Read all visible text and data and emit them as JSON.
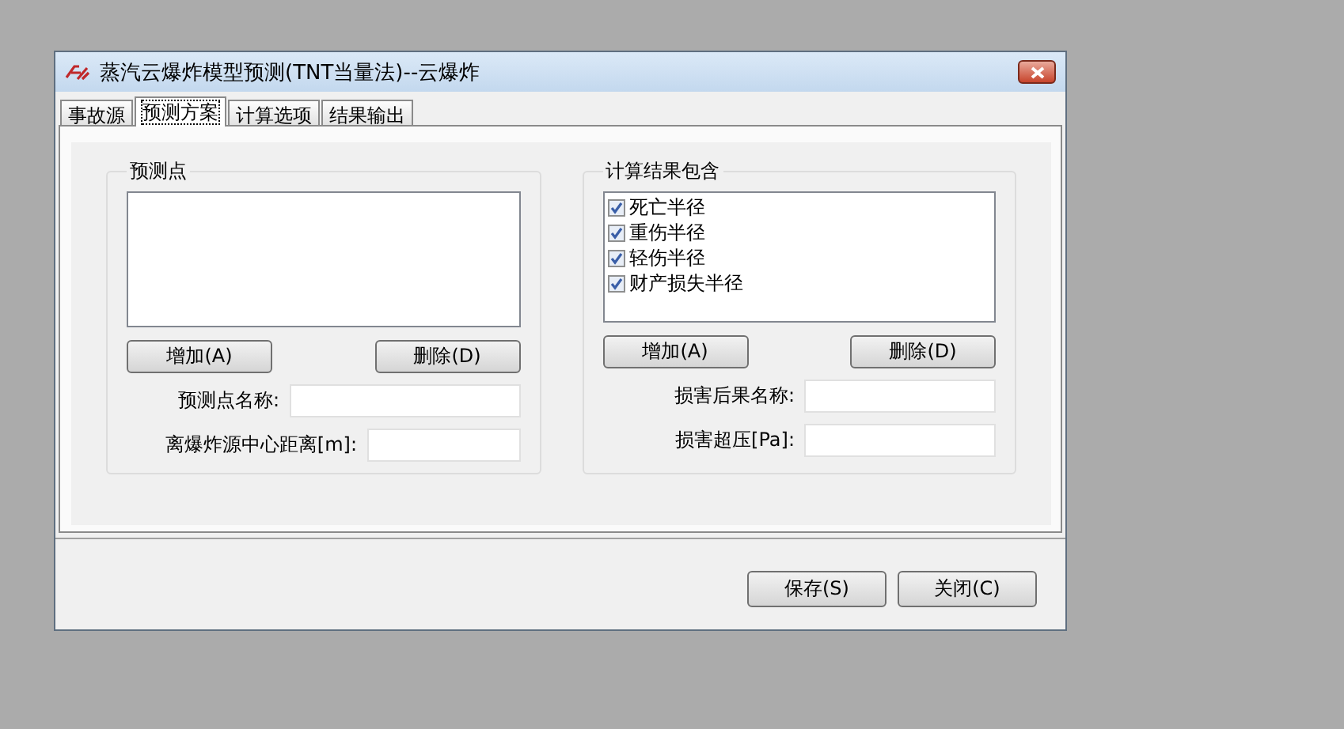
{
  "window": {
    "title": "蒸汽云爆炸模型预测(TNT当量法)--云爆炸"
  },
  "tabs": [
    {
      "label": "事故源",
      "selected": false
    },
    {
      "label": "预测方案",
      "selected": true
    },
    {
      "label": "计算选项",
      "selected": false
    },
    {
      "label": "结果输出",
      "selected": false
    }
  ],
  "groups": [
    {
      "title": "预测点",
      "buttons": [
        "增加(A)",
        "删除(D)"
      ],
      "fields": [
        {
          "label": "预测点名称:"
        },
        {
          "label": "离爆炸源中心距离[m]:"
        }
      ]
    },
    {
      "title": "计算结果包含",
      "items": [
        {
          "label": "死亡半径",
          "checked": true
        },
        {
          "label": "重伤半径",
          "checked": true
        },
        {
          "label": "轻伤半径",
          "checked": true
        },
        {
          "label": "财产损失半径",
          "checked": true
        }
      ],
      "buttons": [
        "增加(A)",
        "删除(D)"
      ],
      "fields": [
        {
          "label": "损害后果名称:"
        },
        {
          "label": "损害超压[Pa]:"
        }
      ]
    }
  ],
  "buttons": [
    "保存(S)",
    "关闭(C)"
  ]
}
